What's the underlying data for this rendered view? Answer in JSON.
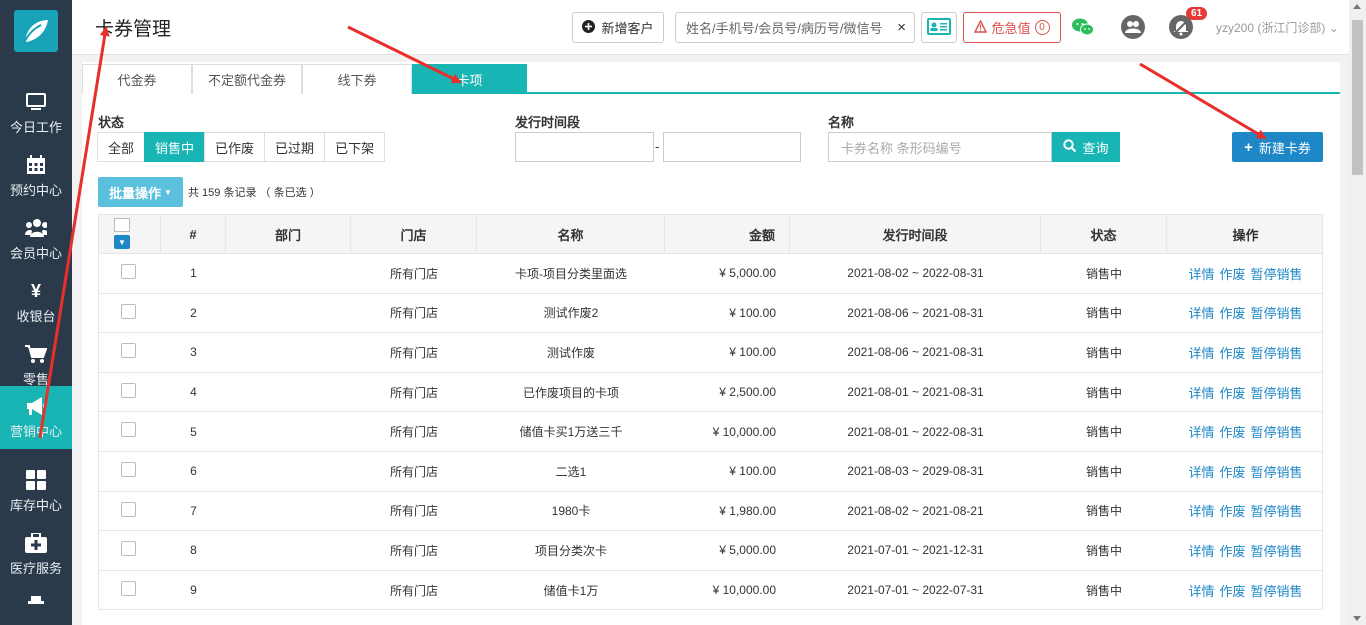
{
  "sidebar": {
    "items": [
      {
        "label": "今日工作",
        "icon": "monitor-icon"
      },
      {
        "label": "预约中心",
        "icon": "calendar-icon"
      },
      {
        "label": "会员中心",
        "icon": "users-icon"
      },
      {
        "label": "收银台",
        "icon": "yen-icon"
      },
      {
        "label": "零售",
        "icon": "cart-icon"
      },
      {
        "label": "营销中心",
        "icon": "megaphone-icon"
      },
      {
        "label": "库存中心",
        "icon": "grid-icon"
      },
      {
        "label": "医疗服务",
        "icon": "medkit-icon"
      }
    ],
    "active_index": 5
  },
  "header": {
    "title": "卡券管理",
    "add_customer": "新增客户",
    "search_placeholder": "姓名/手机号/会员号/病历号/微信号",
    "clear": "×",
    "critical_label": "危急值",
    "critical_count": "0",
    "notification_count": "61",
    "user": "yzy200 (浙江门诊部)"
  },
  "tabs": [
    {
      "label": "代金券"
    },
    {
      "label": "不定额代金券"
    },
    {
      "label": "线下券"
    },
    {
      "label": "卡项"
    }
  ],
  "filters": {
    "status_label": "状态",
    "status_options": [
      "全部",
      "销售中",
      "已作废",
      "已过期",
      "已下架"
    ],
    "status_selected": "销售中",
    "period_label": "发行时间段",
    "period_dash": "-",
    "name_label": "名称",
    "name_placeholder": "卡券名称 条形码编号",
    "query_button": "查询",
    "new_card_button": "新建卡券"
  },
  "toolbar": {
    "batch_button": "批量操作",
    "record_info": "共 159 条记录 （ 条已选 ）"
  },
  "table": {
    "columns": [
      "#",
      "部门",
      "门店",
      "名称",
      "金额",
      "发行时间段",
      "状态",
      "操作"
    ],
    "rows": [
      {
        "no": "1",
        "dept": "",
        "store": "所有门店",
        "name": "卡项-项目分类里面选",
        "amount": "¥ 5,000.00",
        "period": "2021-08-02 ~ 2022-08-31",
        "status": "销售中"
      },
      {
        "no": "2",
        "dept": "",
        "store": "所有门店",
        "name": "测试作废2",
        "amount": "¥ 100.00",
        "period": "2021-08-06 ~ 2021-08-31",
        "status": "销售中"
      },
      {
        "no": "3",
        "dept": "",
        "store": "所有门店",
        "name": "测试作废",
        "amount": "¥ 100.00",
        "period": "2021-08-06 ~ 2021-08-31",
        "status": "销售中"
      },
      {
        "no": "4",
        "dept": "",
        "store": "所有门店",
        "name": "已作废项目的卡项",
        "amount": "¥ 2,500.00",
        "period": "2021-08-01 ~ 2021-08-31",
        "status": "销售中"
      },
      {
        "no": "5",
        "dept": "",
        "store": "所有门店",
        "name": "储值卡买1万送三千",
        "amount": "¥ 10,000.00",
        "period": "2021-08-01 ~ 2022-08-31",
        "status": "销售中"
      },
      {
        "no": "6",
        "dept": "",
        "store": "所有门店",
        "name": "二选1",
        "amount": "¥ 100.00",
        "period": "2021-08-03 ~ 2029-08-31",
        "status": "销售中"
      },
      {
        "no": "7",
        "dept": "",
        "store": "所有门店",
        "name": "1980卡",
        "amount": "¥ 1,980.00",
        "period": "2021-08-02 ~ 2021-08-21",
        "status": "销售中"
      },
      {
        "no": "8",
        "dept": "",
        "store": "所有门店",
        "name": "项目分类次卡",
        "amount": "¥ 5,000.00",
        "period": "2021-07-01 ~ 2021-12-31",
        "status": "销售中"
      },
      {
        "no": "9",
        "dept": "",
        "store": "所有门店",
        "name": "储值卡1万",
        "amount": "¥ 10,000.00",
        "period": "2021-07-01 ~ 2022-07-31",
        "status": "销售中"
      }
    ],
    "actions": [
      "详情",
      "作废",
      "暂停销售"
    ]
  },
  "colors": {
    "sidebar_bg": "#2b3a4a",
    "accent_teal": "#19b5b5",
    "primary_blue": "#1e88c7",
    "danger_red": "#d9534f",
    "annotation_arrow": "#e8302a"
  }
}
